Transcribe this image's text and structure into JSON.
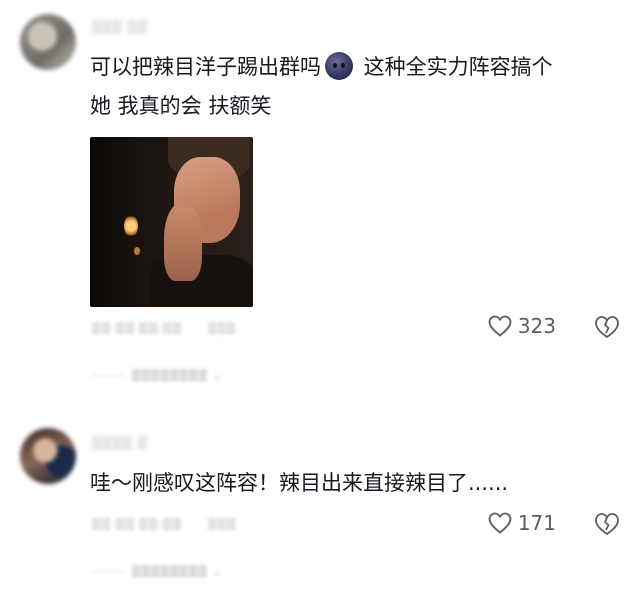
{
  "comments": [
    {
      "username": "",
      "text_part1": "可以把辣目洋子踢出群吗",
      "text_part2": " 这种全实力阵容搞个\n她 我真的会 扶额笑",
      "emoji": "dark-moon-face-emoji",
      "meta_date": "",
      "meta_reply": "",
      "likes": "323",
      "expand_replies": ""
    },
    {
      "username": "",
      "text": "哇～刚感叹这阵容！辣目出来直接辣目了......",
      "meta_date": "",
      "meta_reply": "",
      "likes": "171",
      "expand_replies": ""
    }
  ],
  "colors": {
    "text": "#161823",
    "muted": "#5c5c66",
    "background": "#ffffff"
  },
  "icons": [
    "heart-outline-icon",
    "broken-heart-icon"
  ]
}
